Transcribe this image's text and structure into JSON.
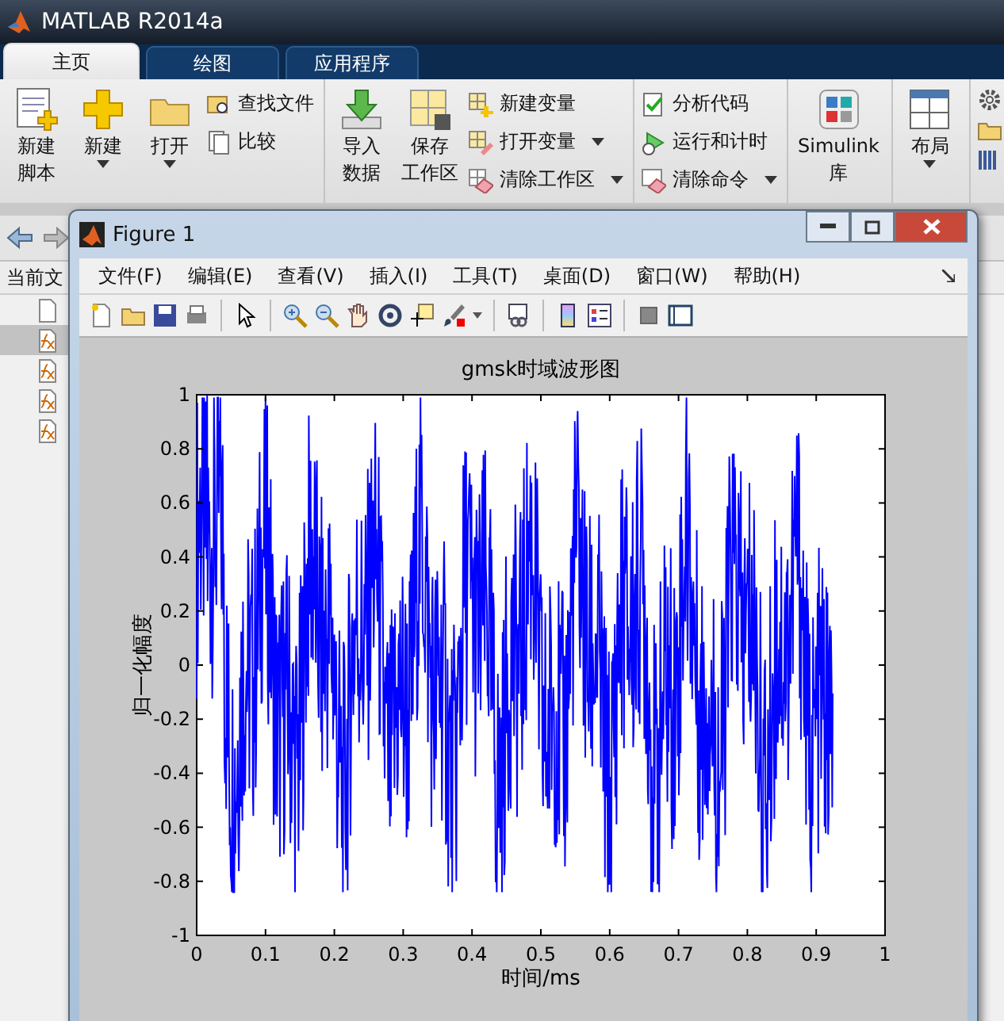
{
  "window": {
    "title": "MATLAB R2014a"
  },
  "tabs": [
    {
      "label": "主页",
      "selected": true
    },
    {
      "label": "绘图",
      "selected": false
    },
    {
      "label": "应用程序",
      "selected": false
    }
  ],
  "ribbon": {
    "groups": [
      {
        "large": [
          {
            "lines": [
              "新建",
              "脚本"
            ],
            "dropdown": false
          },
          {
            "lines": [
              "新建"
            ],
            "dropdown": true
          },
          {
            "lines": [
              "打开"
            ],
            "dropdown": true
          }
        ],
        "small": [
          {
            "label": "查找文件",
            "dropdown": false
          },
          {
            "label": "比较",
            "dropdown": false
          }
        ]
      },
      {
        "large": [
          {
            "lines": [
              "导入",
              "数据"
            ],
            "dropdown": false
          },
          {
            "lines": [
              "保存",
              "工作区"
            ],
            "dropdown": false
          }
        ],
        "small": [
          {
            "label": "新建变量",
            "dropdown": false
          },
          {
            "label": "打开变量",
            "dropdown": true
          },
          {
            "label": "清除工作区",
            "dropdown": true
          }
        ]
      },
      {
        "small": [
          {
            "label": "分析代码",
            "dropdown": false
          },
          {
            "label": "运行和计时",
            "dropdown": false
          },
          {
            "label": "清除命令",
            "dropdown": true
          }
        ]
      },
      {
        "large": [
          {
            "lines": [
              "Simulink",
              "库"
            ],
            "dropdown": false
          }
        ]
      },
      {
        "large": [
          {
            "lines": [
              "布局"
            ],
            "dropdown": true
          }
        ]
      }
    ]
  },
  "current_folder": {
    "header": "当前文",
    "rows": [
      {
        "kind": "file",
        "selected": false
      },
      {
        "kind": "function",
        "selected": true
      },
      {
        "kind": "function",
        "selected": false
      },
      {
        "kind": "function",
        "selected": false
      },
      {
        "kind": "function",
        "selected": false
      }
    ]
  },
  "figure": {
    "title": "Figure 1",
    "menu": [
      "文件(F)",
      "编辑(E)",
      "查看(V)",
      "插入(I)",
      "工具(T)",
      "桌面(D)",
      "窗口(W)",
      "帮助(H)"
    ],
    "plot": {
      "title": "gmsk时域波形图",
      "xlabel": "时间/ms",
      "ylabel": "归一化幅度",
      "xticks": [
        "0",
        "0.1",
        "0.2",
        "0.3",
        "0.4",
        "0.5",
        "0.6",
        "0.7",
        "0.8",
        "0.9",
        "1"
      ],
      "yticks": [
        "1",
        "0.8",
        "0.6",
        "0.4",
        "0.2",
        "0",
        "-0.2",
        "-0.4",
        "-0.6",
        "-0.8",
        "-1"
      ]
    }
  }
}
